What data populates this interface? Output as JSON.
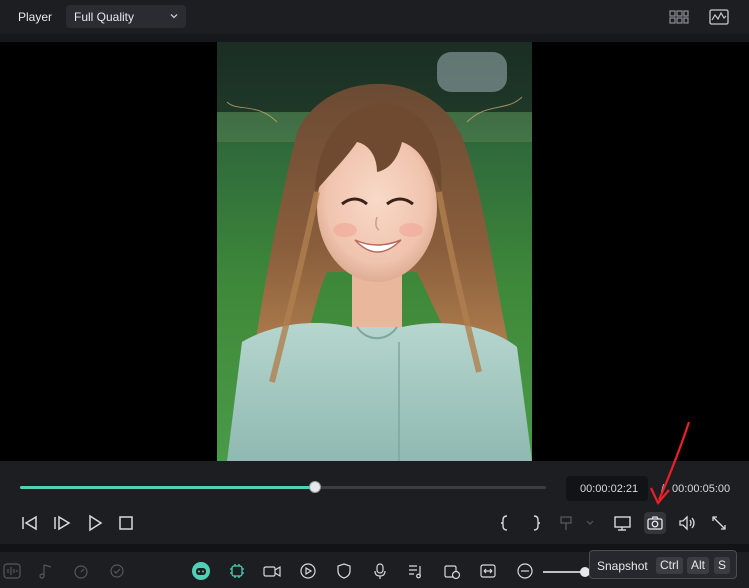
{
  "header": {
    "title": "Player",
    "quality_label": "Full Quality"
  },
  "player": {
    "progress": 0.56,
    "current_time": "00:00:02:21",
    "time_separator": "/",
    "total_time": "00:00:05:00"
  },
  "tooltip": {
    "label": "Snapshot",
    "keys": [
      "Ctrl",
      "Alt",
      "S"
    ]
  },
  "colors": {
    "accent": "#4fd1b6",
    "annotation_arrow": "#e8202a",
    "panel": "#1c1e22"
  },
  "icons": {
    "top_right": [
      "grid-view-icon",
      "waveform-monitor-icon"
    ],
    "playback": [
      "step-back-icon",
      "step-forward-icon",
      "play-icon",
      "stop-icon"
    ],
    "right_controls": [
      "mark-in-icon",
      "mark-out-icon",
      "insert-icon",
      "display-icon",
      "camera-icon",
      "volume-icon",
      "fullscreen-icon"
    ]
  }
}
